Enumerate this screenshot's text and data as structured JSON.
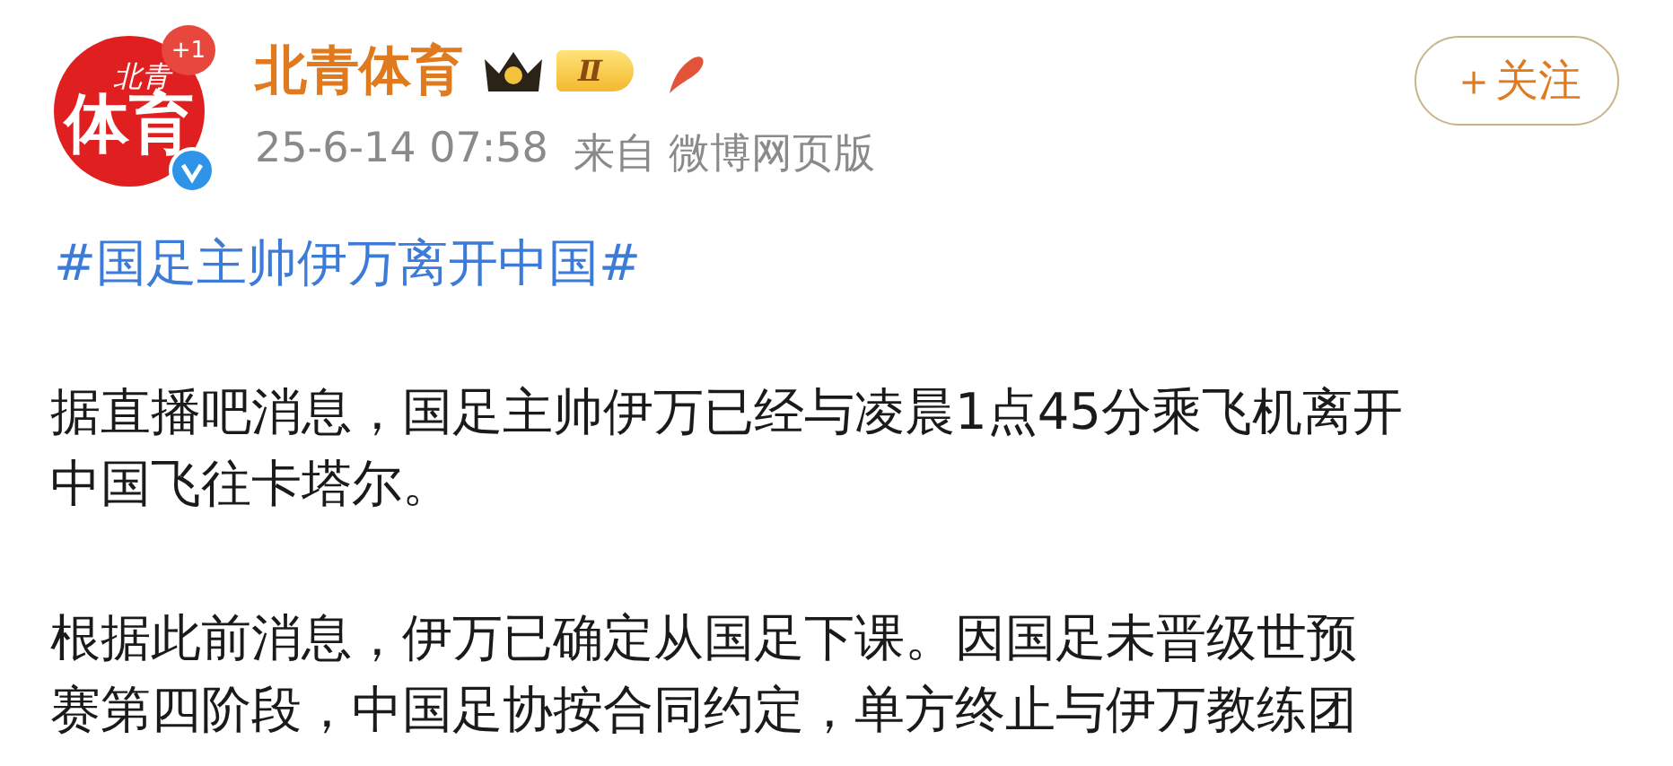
{
  "author": {
    "avatar_text_top": "北青",
    "avatar_text_bottom": "体育",
    "avatar_badge": "+1",
    "verified": true,
    "name": "北青体育",
    "level_badge": "Ⅱ"
  },
  "meta": {
    "time": "25-6-14 07:58",
    "source_label": "来自",
    "source": "微博网页版"
  },
  "follow_button": "＋关注",
  "hashtag": "#国足主帅伊万离开中国#",
  "paragraphs": [
    {
      "lines": [
        "据直播吧消息，国足主帅伊万已经与凌晨1点45分乘飞机离开",
        "中国飞往卡塔尔。"
      ]
    },
    {
      "lines": [
        "根据此前消息，伊万已确定从国足下课。因国足未晋级世预",
        "赛第四阶段，中国足协按合同约定，单方终止与伊万教练团"
      ]
    }
  ]
}
